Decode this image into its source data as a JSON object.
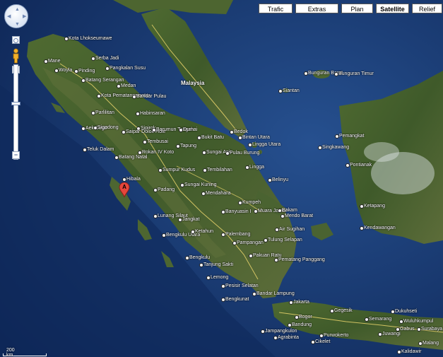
{
  "map_types": [
    {
      "label": "Trafic",
      "active": false
    },
    {
      "label": "Extras",
      "active": false
    },
    {
      "label": "Plan",
      "active": false
    },
    {
      "label": "Satellite",
      "active": true
    },
    {
      "label": "Relief",
      "active": false
    }
  ],
  "marker": {
    "label": "A",
    "color": "#e5463c"
  },
  "zoom": {
    "plus": "+",
    "minus": "−",
    "level": 0.62
  },
  "scale": {
    "label": "200 km"
  },
  "places": [
    {
      "name": "Malaysia",
      "big": true
    },
    {
      "name": "Kota Lhokseumawe"
    },
    {
      "name": "Serba Jadi"
    },
    {
      "name": "Pangkalan Susu"
    },
    {
      "name": "Mane"
    },
    {
      "name": "Woyla"
    },
    {
      "name": "Pinding"
    },
    {
      "name": "Batang Serangan"
    },
    {
      "name": "Medan"
    },
    {
      "name": "Kota Pematangsiantar"
    },
    {
      "name": "Bandar Pulau"
    },
    {
      "name": "Parlilitan"
    },
    {
      "name": "Habinsaran"
    },
    {
      "name": "Aek Sogo"
    },
    {
      "name": "Sigadong"
    },
    {
      "name": "Sipirok"
    },
    {
      "name": "Saipar Dolok Hole"
    },
    {
      "name": "Barumun Tengah"
    },
    {
      "name": "Dumai"
    },
    {
      "name": "Tembusai"
    },
    {
      "name": "Bukit Batu"
    },
    {
      "name": "Bedok"
    },
    {
      "name": "Bintan Utara"
    },
    {
      "name": "Teluk Dalam"
    },
    {
      "name": "Batang Natal"
    },
    {
      "name": "Rokan IV Koto"
    },
    {
      "name": "Tapung"
    },
    {
      "name": "Sungai Apit"
    },
    {
      "name": "Pulau Burung"
    },
    {
      "name": "Lingga Utara"
    },
    {
      "name": "Sumpur Kudus"
    },
    {
      "name": "Tembilahan"
    },
    {
      "name": "Lingga"
    },
    {
      "name": "Hibala"
    },
    {
      "name": "Padang"
    },
    {
      "name": "Sungai Kuning"
    },
    {
      "name": "Mendahara"
    },
    {
      "name": "Belinyu"
    },
    {
      "name": "Kumpeh"
    },
    {
      "name": "Banyuasin I"
    },
    {
      "name": "Muara Jambi"
    },
    {
      "name": "Bakam"
    },
    {
      "name": "Mendo Barat"
    },
    {
      "name": "Lunang Silaut"
    },
    {
      "name": "Jangkat"
    },
    {
      "name": "Bengkulu Utara"
    },
    {
      "name": "Ketahun"
    },
    {
      "name": "Palembang"
    },
    {
      "name": "Air Sugihan"
    },
    {
      "name": "Tulung Selapan"
    },
    {
      "name": "Pampangan"
    },
    {
      "name": "Bengkulu"
    },
    {
      "name": "Tanjung Sakti"
    },
    {
      "name": "Pakuan Ratu"
    },
    {
      "name": "Pematang Panggang"
    },
    {
      "name": "Lemong"
    },
    {
      "name": "Pesisir Selatan"
    },
    {
      "name": "Bengkunat"
    },
    {
      "name": "Bandar Lampung"
    },
    {
      "name": "Siantan"
    },
    {
      "name": "Bunguran Barat"
    },
    {
      "name": "Bunguran Timur"
    },
    {
      "name": "Pemangkat"
    },
    {
      "name": "Singkawang"
    },
    {
      "name": "Pontianak"
    },
    {
      "name": "Ketapang"
    },
    {
      "name": "Kendawangan"
    },
    {
      "name": "Jakarta"
    },
    {
      "name": "Gegesik"
    },
    {
      "name": "Bogor"
    },
    {
      "name": "Bandung"
    },
    {
      "name": "Jampangkulon"
    },
    {
      "name": "Agrabinta"
    },
    {
      "name": "Purwokerto"
    },
    {
      "name": "Cikelet"
    },
    {
      "name": "Semarang"
    },
    {
      "name": "Dukuhseti"
    },
    {
      "name": "Wuluhkumpul"
    },
    {
      "name": "Gabus"
    },
    {
      "name": "Juwangi"
    },
    {
      "name": "Surabaya"
    },
    {
      "name": "Malang"
    },
    {
      "name": "Kalidawir"
    }
  ]
}
